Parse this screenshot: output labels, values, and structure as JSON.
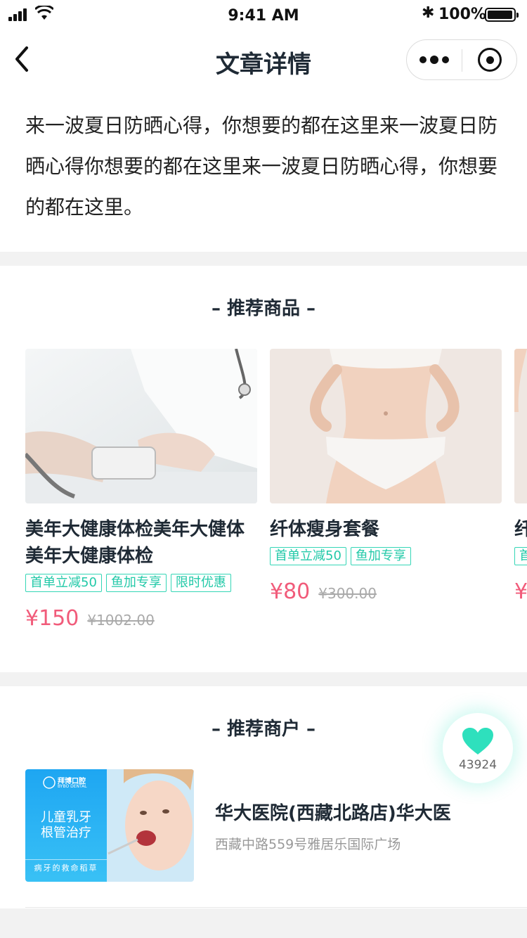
{
  "status_bar": {
    "time": "9:41 AM",
    "battery": "100%"
  },
  "nav": {
    "title": "文章详情"
  },
  "article": {
    "text": "来一波夏日防晒心得，你想要的都在这里来一波夏日防晒心得你想要的都在这里来一波夏日防晒心得，你想要的都在这里。"
  },
  "products": {
    "title": "– 推荐商品 –",
    "items": [
      {
        "name": "美年大健康体检美年大健体美年大健康体检",
        "tags": [
          "首单立减50",
          "鱼加专享",
          "限时优惠"
        ],
        "price": "¥150",
        "original_price": "¥1002.00"
      },
      {
        "name": "纤体瘦身套餐",
        "tags": [
          "首单立减50",
          "鱼加专享"
        ],
        "price": "¥80",
        "original_price": "¥300.00"
      },
      {
        "name": "纤",
        "tags": [
          "首"
        ],
        "price": "¥",
        "original_price": ""
      }
    ]
  },
  "merchants": {
    "title": "– 推荐商户 –",
    "items": [
      {
        "name": "华大医院(西藏北路店)华大医",
        "address": "西藏中路559号雅居乐国际广场",
        "image_text": {
          "brand": "拜博口腔",
          "brand_en": "BYBO DENTAL",
          "headline": "儿童乳牙\n根管治疗",
          "footer": "病牙的救命稻草"
        }
      }
    ]
  },
  "like": {
    "count": "43924"
  },
  "colors": {
    "accent": "#22c9a8",
    "price": "#f15b7a",
    "heart": "#2ee0bd",
    "title": "#1f2a35"
  }
}
